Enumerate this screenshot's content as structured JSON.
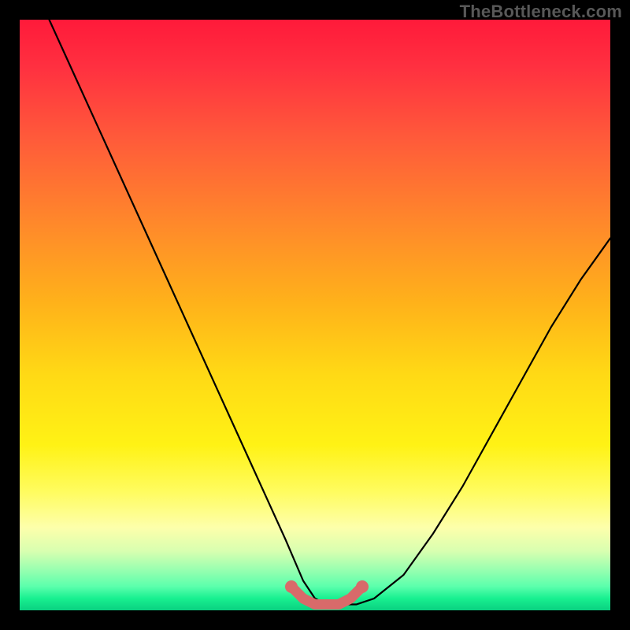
{
  "watermark": "TheBottleneck.com",
  "chart_data": {
    "type": "line",
    "title": "",
    "xlabel": "",
    "ylabel": "",
    "xlim": [
      0,
      100
    ],
    "ylim": [
      0,
      100
    ],
    "series": [
      {
        "name": "bottleneck-curve",
        "color": "#000000",
        "x": [
          5,
          10,
          15,
          20,
          25,
          30,
          35,
          40,
          45,
          48,
          50,
          52,
          55,
          57,
          60,
          65,
          70,
          75,
          80,
          85,
          90,
          95,
          100
        ],
        "y": [
          100,
          89,
          78,
          67,
          56,
          45,
          34,
          23,
          12,
          5,
          2,
          1,
          1,
          1,
          2,
          6,
          13,
          21,
          30,
          39,
          48,
          56,
          63
        ]
      },
      {
        "name": "optimal-zone",
        "color": "#d86a6a",
        "x": [
          46,
          48,
          50,
          52,
          54,
          56,
          58
        ],
        "y": [
          4,
          2,
          1,
          1,
          1,
          2,
          4
        ]
      }
    ],
    "gradient_stops": [
      {
        "pos": 0,
        "color": "#ff1a3a"
      },
      {
        "pos": 35,
        "color": "#ff8a2a"
      },
      {
        "pos": 60,
        "color": "#ffd915"
      },
      {
        "pos": 86,
        "color": "#fdffab"
      },
      {
        "pos": 100,
        "color": "#0ad080"
      }
    ]
  }
}
